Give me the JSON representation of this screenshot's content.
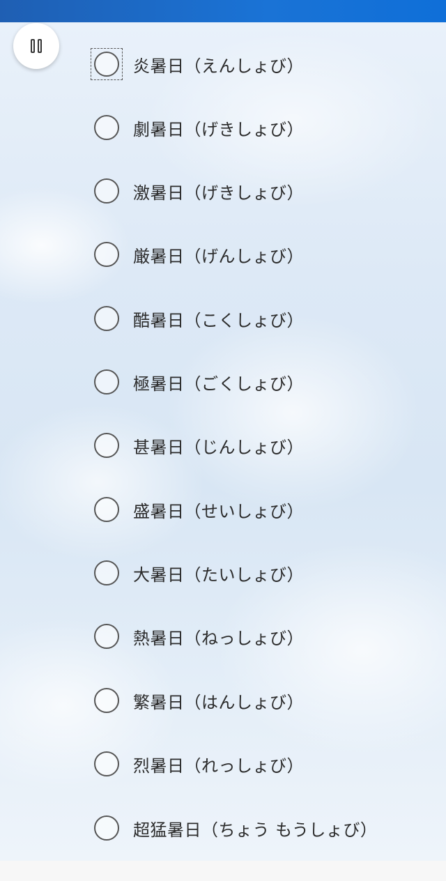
{
  "header": {
    "pause_icon": "pause-icon"
  },
  "options": [
    {
      "label": "炎暑日（えんしょび）",
      "selected": false,
      "focused": true
    },
    {
      "label": "劇暑日（げきしょび）",
      "selected": false,
      "focused": false
    },
    {
      "label": "激暑日（げきしょび）",
      "selected": false,
      "focused": false
    },
    {
      "label": "厳暑日（げんしょび）",
      "selected": false,
      "focused": false
    },
    {
      "label": "酷暑日（こくしょび）",
      "selected": false,
      "focused": false
    },
    {
      "label": "極暑日（ごくしょび）",
      "selected": false,
      "focused": false
    },
    {
      "label": "甚暑日（じんしょび）",
      "selected": false,
      "focused": false
    },
    {
      "label": "盛暑日（せいしょび）",
      "selected": false,
      "focused": false
    },
    {
      "label": "大暑日（たいしょび）",
      "selected": false,
      "focused": false
    },
    {
      "label": "熱暑日（ねっしょび）",
      "selected": false,
      "focused": false
    },
    {
      "label": "繁暑日（はんしょび）",
      "selected": false,
      "focused": false
    },
    {
      "label": "烈暑日（れっしょび）",
      "selected": false,
      "focused": false
    },
    {
      "label": "超猛暑日（ちょう もうしょび）",
      "selected": false,
      "focused": false
    }
  ],
  "colors": {
    "top_bar": "#1a73d6",
    "radio_border": "#555555",
    "text": "#2b2b2b"
  }
}
